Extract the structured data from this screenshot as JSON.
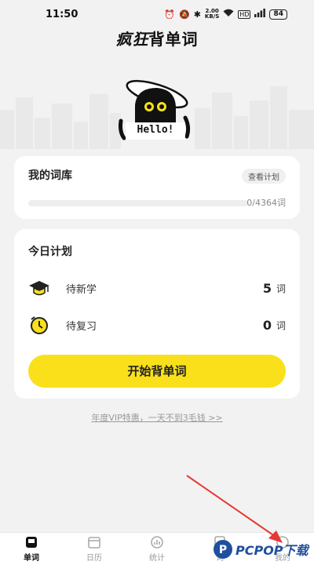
{
  "status_bar": {
    "time": "11:50",
    "net_speed_top": "2.00",
    "net_speed_bottom": "KB/S",
    "hd_label": "HD",
    "battery": "84"
  },
  "app": {
    "title_bold": "疯狂",
    "title_rest": "背单词"
  },
  "mascot": {
    "greeting": "Hello!"
  },
  "library": {
    "title": "我的词库",
    "view_plan_label": "查看计划",
    "progress_text": "0/4364词",
    "progress_fraction": 0
  },
  "plan": {
    "title": "今日计划",
    "items": [
      {
        "label": "待新学",
        "count": "5",
        "unit": "词",
        "icon": "graduation-cap-icon"
      },
      {
        "label": "待复习",
        "count": "0",
        "unit": "词",
        "icon": "review-clock-icon"
      }
    ],
    "start_button": "开始背单词"
  },
  "vip_link": "年度VIP特惠，一天不到3毛钱 >>",
  "tabs": [
    {
      "label": "单词",
      "icon": "book-icon",
      "active": true
    },
    {
      "label": "日历",
      "icon": "calendar-icon",
      "active": false
    },
    {
      "label": "统计",
      "icon": "stats-icon",
      "active": false
    },
    {
      "label": "词",
      "icon": "word-icon",
      "active": false
    },
    {
      "label": "我的",
      "icon": "profile-icon",
      "active": false
    }
  ],
  "watermark": {
    "text": "PCPOP下载"
  },
  "colors": {
    "accent": "#f9e01b",
    "background": "#f2f2f2",
    "annotation_arrow": "#e53935"
  }
}
